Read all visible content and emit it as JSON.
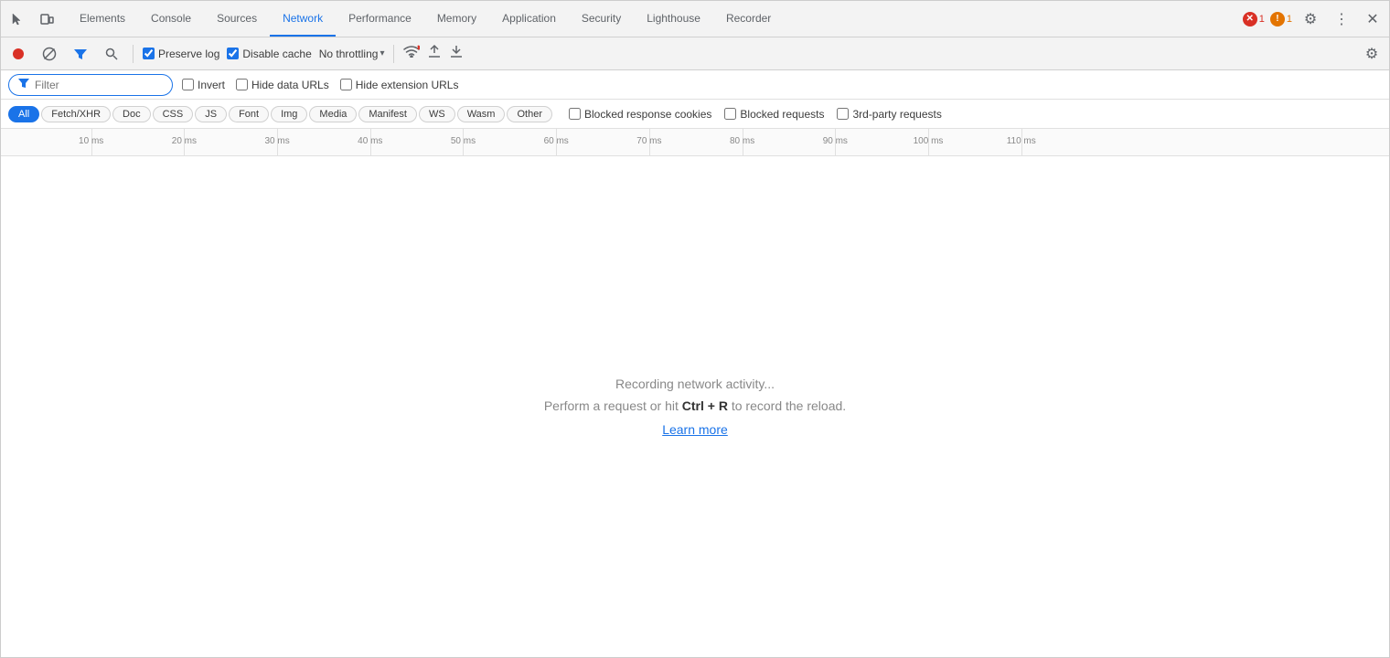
{
  "nav": {
    "tabs": [
      {
        "id": "elements",
        "label": "Elements",
        "active": false
      },
      {
        "id": "console",
        "label": "Console",
        "active": false
      },
      {
        "id": "sources",
        "label": "Sources",
        "active": false
      },
      {
        "id": "network",
        "label": "Network",
        "active": true
      },
      {
        "id": "performance",
        "label": "Performance",
        "active": false
      },
      {
        "id": "memory",
        "label": "Memory",
        "active": false
      },
      {
        "id": "application",
        "label": "Application",
        "active": false
      },
      {
        "id": "security",
        "label": "Security",
        "active": false
      },
      {
        "id": "lighthouse",
        "label": "Lighthouse",
        "active": false
      },
      {
        "id": "recorder",
        "label": "Recorder",
        "active": false
      }
    ],
    "error_count": "1",
    "warn_count": "1"
  },
  "toolbar": {
    "preserve_log_label": "Preserve log",
    "disable_cache_label": "Disable cache",
    "throttle_label": "No throttling",
    "preserve_log_checked": true,
    "disable_cache_checked": true
  },
  "filter": {
    "placeholder": "Filter",
    "invert_label": "Invert",
    "hide_data_urls_label": "Hide data URLs",
    "hide_extension_urls_label": "Hide extension URLs"
  },
  "type_tabs": [
    {
      "id": "all",
      "label": "All",
      "active": true
    },
    {
      "id": "fetch-xhr",
      "label": "Fetch/XHR",
      "active": false
    },
    {
      "id": "doc",
      "label": "Doc",
      "active": false
    },
    {
      "id": "css",
      "label": "CSS",
      "active": false
    },
    {
      "id": "js",
      "label": "JS",
      "active": false
    },
    {
      "id": "font",
      "label": "Font",
      "active": false
    },
    {
      "id": "img",
      "label": "Img",
      "active": false
    },
    {
      "id": "media",
      "label": "Media",
      "active": false
    },
    {
      "id": "manifest",
      "label": "Manifest",
      "active": false
    },
    {
      "id": "ws",
      "label": "WS",
      "active": false
    },
    {
      "id": "wasm",
      "label": "Wasm",
      "active": false
    },
    {
      "id": "other",
      "label": "Other",
      "active": false
    }
  ],
  "type_checkboxes": [
    {
      "id": "blocked-response",
      "label": "Blocked response cookies",
      "checked": false
    },
    {
      "id": "blocked-requests",
      "label": "Blocked requests",
      "checked": false
    },
    {
      "id": "third-party",
      "label": "3rd-party requests",
      "checked": false
    }
  ],
  "timeline": {
    "ticks": [
      {
        "ms": "10 ms",
        "offset_pct": 6.5
      },
      {
        "ms": "20 ms",
        "offset_pct": 13.2
      },
      {
        "ms": "30 ms",
        "offset_pct": 19.9
      },
      {
        "ms": "40 ms",
        "offset_pct": 26.6
      },
      {
        "ms": "50 ms",
        "offset_pct": 33.3
      },
      {
        "ms": "60 ms",
        "offset_pct": 40.0
      },
      {
        "ms": "70 ms",
        "offset_pct": 46.7
      },
      {
        "ms": "80 ms",
        "offset_pct": 53.4
      },
      {
        "ms": "90 ms",
        "offset_pct": 60.1
      },
      {
        "ms": "100 ms",
        "offset_pct": 66.8
      },
      {
        "ms": "110 ms",
        "offset_pct": 73.5
      }
    ]
  },
  "main": {
    "recording_text": "Recording network activity...",
    "instruction_text_before": "Perform a request or hit ",
    "instruction_shortcut": "Ctrl + R",
    "instruction_text_after": " to record the reload.",
    "learn_more_label": "Learn more"
  }
}
